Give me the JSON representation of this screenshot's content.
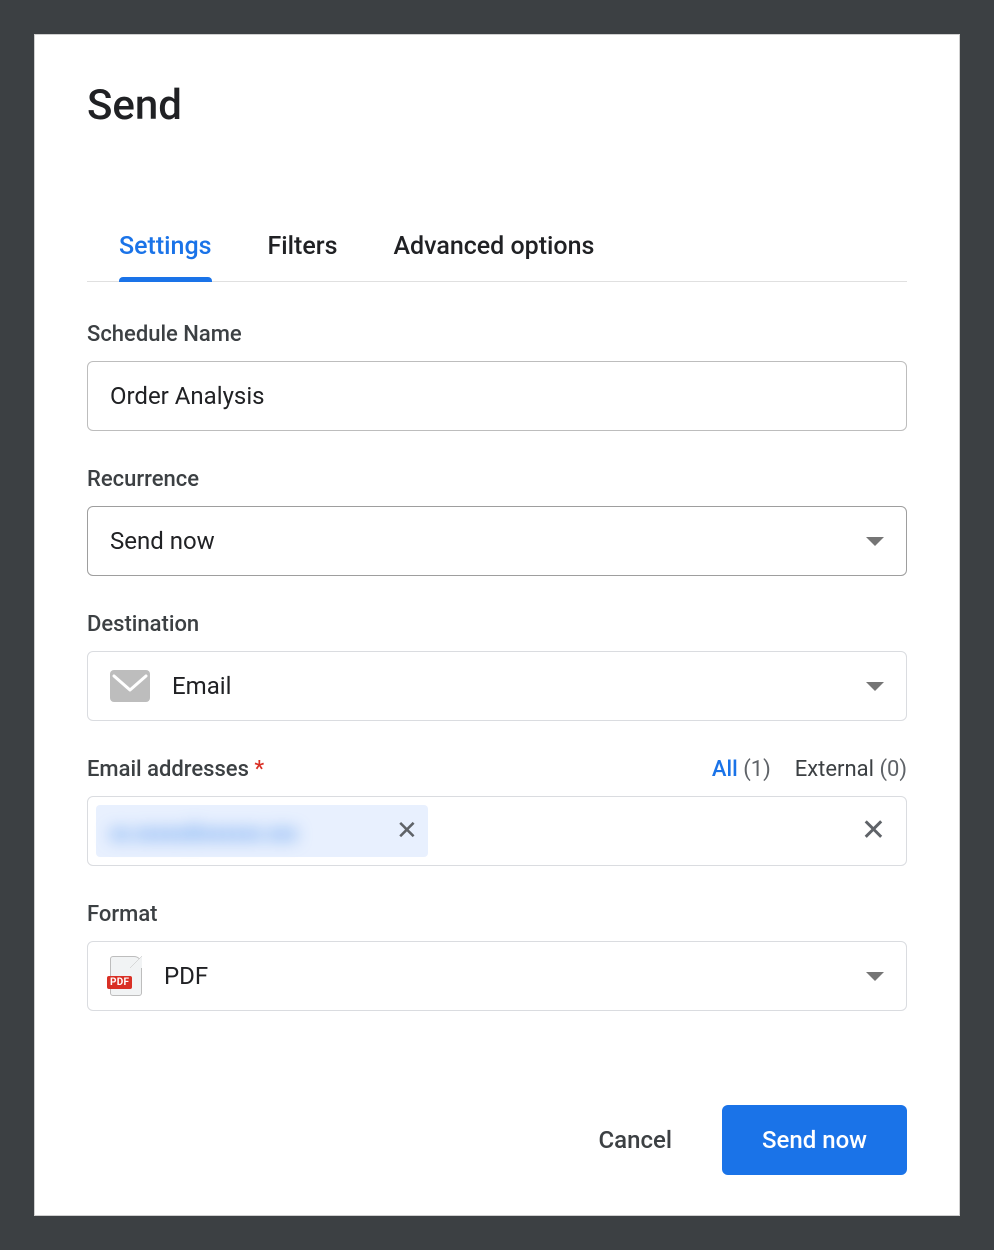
{
  "dialog": {
    "title": "Send",
    "tabs": [
      {
        "label": "Settings",
        "active": true
      },
      {
        "label": "Filters",
        "active": false
      },
      {
        "label": "Advanced options",
        "active": false
      }
    ],
    "footer": {
      "cancel_label": "Cancel",
      "submit_label": "Send now"
    }
  },
  "fields": {
    "schedule_name": {
      "label": "Schedule Name",
      "value": "Order Analysis"
    },
    "recurrence": {
      "label": "Recurrence",
      "selected": "Send now"
    },
    "destination": {
      "label": "Destination",
      "icon": "mail-icon",
      "selected": "Email"
    },
    "email_addresses": {
      "label": "Email addresses",
      "required_mark": "*",
      "filters": {
        "all_label": "All",
        "all_count": "(1)",
        "external_label": "External",
        "external_count": "(0)"
      },
      "chips": [
        {
          "redacted": true,
          "text": "xx.xxxxx@xxxxxx.xxx"
        }
      ]
    },
    "format": {
      "label": "Format",
      "icon": "pdf-icon",
      "icon_badge": "PDF",
      "selected": "PDF"
    }
  }
}
